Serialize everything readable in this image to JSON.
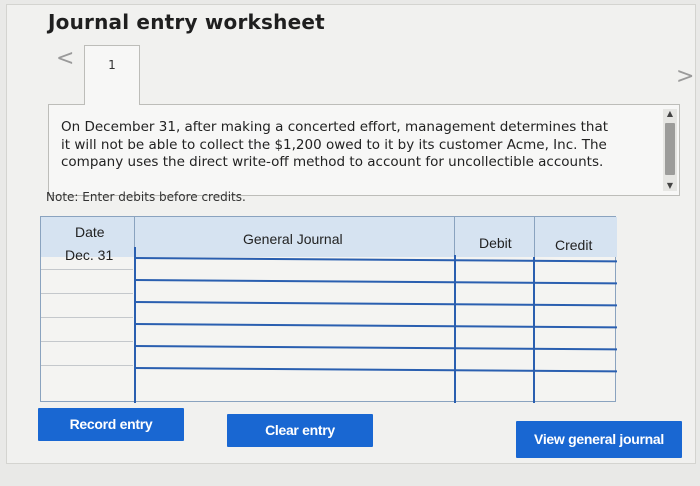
{
  "header": {
    "title": "Journal entry worksheet",
    "prev_icon": "<",
    "next_icon": ">"
  },
  "pager": {
    "current_page": "1"
  },
  "prompt": {
    "text": "On December 31, after making a concerted effort, management determines that it will not be able to collect the $1,200 owed to it by its customer Acme, Inc. The company uses the direct write-off method to account for uncollectible accounts.",
    "scroll_up_icon": "▲",
    "scroll_down_icon": "▼"
  },
  "note": "Note: Enter debits before credits.",
  "journal": {
    "columns": {
      "date": "Date",
      "general_journal": "General Journal",
      "debit": "Debit",
      "credit": "Credit"
    },
    "rows": [
      {
        "date": "Dec. 31",
        "account": "",
        "debit": "",
        "credit": ""
      },
      {
        "date": "",
        "account": "",
        "debit": "",
        "credit": ""
      },
      {
        "date": "",
        "account": "",
        "debit": "",
        "credit": ""
      },
      {
        "date": "",
        "account": "",
        "debit": "",
        "credit": ""
      },
      {
        "date": "",
        "account": "",
        "debit": "",
        "credit": ""
      },
      {
        "date": "",
        "account": "",
        "debit": "",
        "credit": ""
      }
    ]
  },
  "buttons": {
    "record": "Record entry",
    "clear": "Clear entry",
    "view": "View general journal"
  },
  "colors": {
    "button_blue": "#1967d2",
    "header_blue": "#d6e3f1",
    "grid_line_blue": "#2a5fb0"
  }
}
